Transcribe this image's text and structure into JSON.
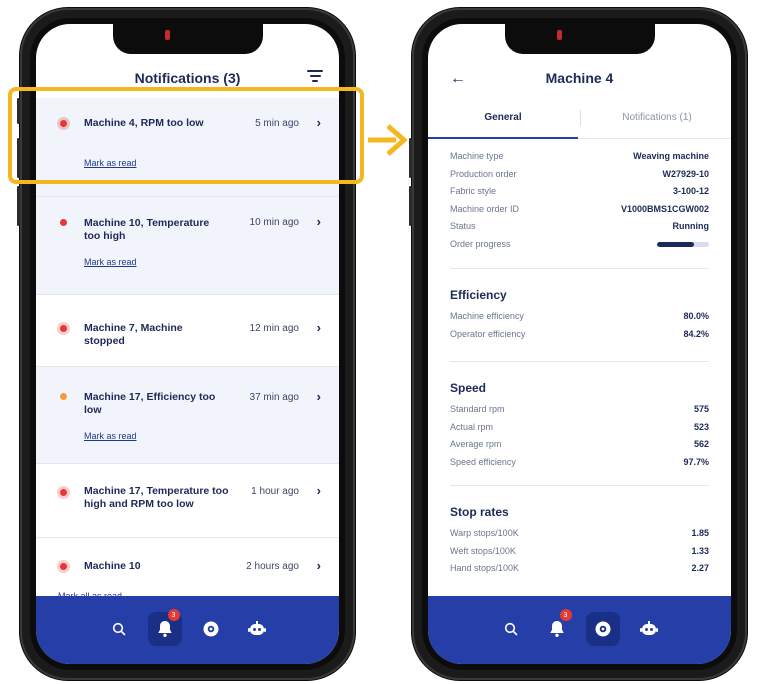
{
  "left": {
    "header_title": "Notifications (3)",
    "notifications": [
      {
        "title": "Machine 4, RPM too low",
        "time": "5 min ago",
        "mark": "Mark as read",
        "dot_color": "#e53935",
        "ring": true,
        "unread": true
      },
      {
        "title": "Machine 10, Temperature too high",
        "time": "10 min ago",
        "mark": "Mark as read",
        "dot_color": "#e53935",
        "ring": false,
        "unread": true
      },
      {
        "title": "Machine 7, Machine stopped",
        "time": "12 min ago",
        "mark": "",
        "dot_color": "#e53935",
        "ring": true,
        "unread": false
      },
      {
        "title": "Machine 17, Efficiency too low",
        "time": "37 min ago",
        "mark": "Mark as read",
        "dot_color": "#f59c3a",
        "ring": false,
        "unread": true
      },
      {
        "title": "Machine 17, Temperature too high and RPM too low",
        "time": "1 hour ago",
        "mark": "",
        "dot_color": "#e53935",
        "ring": true,
        "unread": false
      },
      {
        "title": "Machine 10",
        "time": "2 hours ago",
        "mark": "",
        "dot_color": "#e53935",
        "ring": true,
        "unread": false
      }
    ],
    "mark_all": "Mark all as read",
    "tabbar": {
      "badge": "3"
    }
  },
  "right": {
    "header_title": "Machine 4",
    "tab_general": "General",
    "tab_notifications": "Notifications (1)",
    "details": [
      {
        "label": "Machine type",
        "value": "Weaving machine"
      },
      {
        "label": "Production order",
        "value": "W27929-10"
      },
      {
        "label": "Fabric style",
        "value": "3-100-12"
      },
      {
        "label": "Machine order ID",
        "value": "V1000BMS1CGW002"
      },
      {
        "label": "Status",
        "value": "Running"
      }
    ],
    "order_progress_label": "Order progress",
    "order_progress": 0.72,
    "efficiency": {
      "title": "Efficiency",
      "rows": [
        {
          "label": "Machine efficiency",
          "value": "80.0%"
        },
        {
          "label": "Operator efficiency",
          "value": "84.2%"
        }
      ]
    },
    "speed": {
      "title": "Speed",
      "rows": [
        {
          "label": "Standard rpm",
          "value": "575"
        },
        {
          "label": "Actual rpm",
          "value": "523"
        },
        {
          "label": "Average rpm",
          "value": "562"
        },
        {
          "label": "Speed efficiency",
          "value": "97.7%"
        }
      ]
    },
    "stops": {
      "title": "Stop rates",
      "rows": [
        {
          "label": "Warp stops/100K",
          "value": "1.85"
        },
        {
          "label": "Weft stops/100K",
          "value": "1.33"
        },
        {
          "label": "Hand stops/100K",
          "value": "2.27"
        }
      ]
    },
    "tabbar": {
      "badge": "3"
    }
  },
  "colors": {
    "accent": "#263fa8",
    "navy": "#1d2a57",
    "highlight": "#f3b81d",
    "alert_red": "#e53935",
    "alert_orange": "#f59c3a"
  }
}
